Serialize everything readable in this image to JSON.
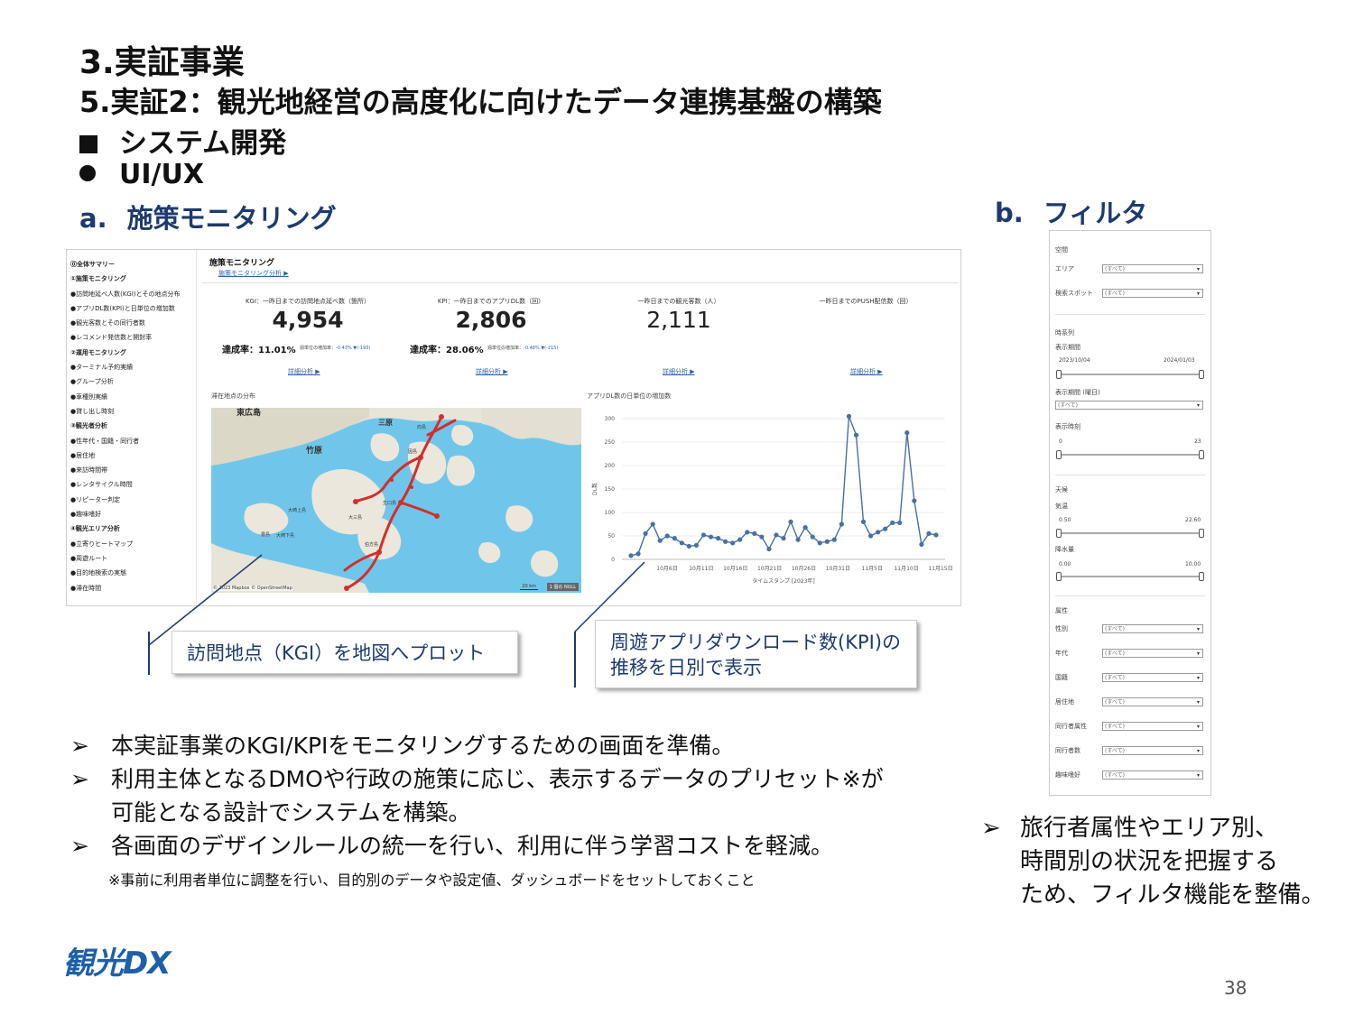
{
  "header": {
    "title": "3.実証事業",
    "subtitle": "5.実証2：観光地経営の高度化に向けたデータ連携基盤の構築",
    "section": "システム開発",
    "subsection": "UI/UX"
  },
  "sections": {
    "a_label": "a.",
    "a_title": "施策モニタリング",
    "b_label": "b.",
    "b_title": "フィルタ"
  },
  "dashboard": {
    "sidebar": [
      {
        "text": "⓪全体サマリー",
        "group": true
      },
      {
        "text": "①施策モニタリング",
        "group": true
      },
      {
        "text": "●訪問地延べ人数(KGI)とその地点分布",
        "group": false
      },
      {
        "text": "●アプリDL数(KPI)と日単位の増加数",
        "group": false
      },
      {
        "text": "●観光客数とその同行者数",
        "group": false
      },
      {
        "text": "●レコメンド発信数と開封率",
        "group": false
      },
      {
        "text": "②運用モニタリング",
        "group": true
      },
      {
        "text": "●ターミナル予約実績",
        "group": false
      },
      {
        "text": "●グループ分析",
        "group": false
      },
      {
        "text": "●車種別実績",
        "group": false
      },
      {
        "text": "●貸し出し時刻",
        "group": false
      },
      {
        "text": "③観光者分析",
        "group": true
      },
      {
        "text": "●性年代・国籍・同行者",
        "group": false
      },
      {
        "text": "●居住地",
        "group": false
      },
      {
        "text": "●来訪時間帯",
        "group": false
      },
      {
        "text": "●レンタサイクル時間",
        "group": false
      },
      {
        "text": "●リピーター判定",
        "group": false
      },
      {
        "text": "●趣味嗜好",
        "group": false
      },
      {
        "text": "④観光エリア分析",
        "group": true
      },
      {
        "text": "●立寄りヒートマップ",
        "group": false
      },
      {
        "text": "●周遊ルート",
        "group": false
      },
      {
        "text": "●目的地検索の実態",
        "group": false
      },
      {
        "text": "●滞在時間",
        "group": false
      }
    ],
    "page_title": "施策モニタリング",
    "page_link": "施策モニタリング分析 ▶",
    "kpis": [
      {
        "label": "KGI：一昨日までの訪問地点延べ数（箇所）",
        "value": "4,954"
      },
      {
        "label": "KPI：一昨日までのアプリDL数（回）",
        "value": "2,806"
      },
      {
        "label": "一昨日までの観光客数（人）",
        "value": "2,111"
      },
      {
        "label": "一昨日までのPUSH配信数（回）",
        "value": ""
      }
    ],
    "rates": [
      {
        "text": "達成率：11.01%",
        "mini_label": "週単位の増加率：",
        "mini_value": "-0.43% ▼(-193)"
      },
      {
        "text": "達成率：28.06%",
        "mini_label": "週単位の増加率：",
        "mini_value": "-0.48% ▼(-215)"
      }
    ],
    "detail_link": "詳細分析 ▶",
    "map_title": "滞在地点の分布",
    "map_attribution": "© 2023 Mapbox © OpenStreetMap",
    "map_scale": "20 km",
    "map_null": "1 個の NULL",
    "map_places": [
      "東広島",
      "竹原",
      "三原",
      "大崎上島",
      "大崎下島",
      "生口島",
      "因島",
      "向島",
      "豊島",
      "伯方島",
      "大三島"
    ],
    "chart_title": "アプリDL数の日単位の増加数"
  },
  "chart_data": {
    "type": "line",
    "title": "アプリDL数の日単位の増加数",
    "xlabel": "タイムスタンプ [2023年]",
    "ylabel": "DL数",
    "ylim": [
      0,
      300
    ],
    "yticks": [
      0,
      50,
      100,
      150,
      200,
      250,
      300
    ],
    "xtick_labels": [
      "10月6日",
      "10月11日",
      "10月16日",
      "10月21日",
      "10月26日",
      "10月31日",
      "11月5日",
      "11月10日",
      "11月15日"
    ],
    "x": [
      "10/4",
      "10/5",
      "10/6",
      "10/7",
      "10/8",
      "10/9",
      "10/10",
      "10/11",
      "10/12",
      "10/13",
      "10/14",
      "10/15",
      "10/16",
      "10/17",
      "10/18",
      "10/19",
      "10/20",
      "10/21",
      "10/22",
      "10/23",
      "10/24",
      "10/25",
      "10/26",
      "10/27",
      "10/28",
      "10/29",
      "10/30",
      "10/31",
      "11/1",
      "11/2",
      "11/3",
      "11/4",
      "11/5",
      "11/6",
      "11/7",
      "11/8",
      "11/9",
      "11/10",
      "11/11",
      "11/12",
      "11/13",
      "11/14",
      "11/15"
    ],
    "values": [
      8,
      12,
      55,
      75,
      40,
      50,
      45,
      35,
      28,
      30,
      52,
      48,
      45,
      38,
      35,
      42,
      58,
      55,
      48,
      22,
      52,
      45,
      80,
      42,
      68,
      48,
      35,
      38,
      42,
      75,
      305,
      265,
      80,
      50,
      58,
      65,
      78,
      78,
      270,
      125,
      32,
      55,
      52
    ]
  },
  "callouts": {
    "left": "訪問地点（KGI）を地図へプロット",
    "right_line1": "周遊アプリダウンロード数(KPI)の",
    "right_line2": "推移を日別で表示"
  },
  "body": {
    "bullets": [
      [
        "本実証事業のKGI/KPIをモニタリングするための画面を準備。"
      ],
      [
        "利用主体となるDMOや行政の施策に応じ、表示するデータのプリセット※が",
        "可能となる設計でシステムを構築。"
      ],
      [
        "各画面のデザインルールの統一を行い、利用に伴う学習コストを軽減。"
      ]
    ],
    "note": "※事前に利用者単位に調整を行い、目的別のデータや設定値、ダッシュボードをセットしておくこと",
    "right_bullet": [
      "旅行者属性やエリア別、",
      "時間別の状況を把握する",
      "ため、フィルタ機能を整備。"
    ],
    "arrow": "➢"
  },
  "filter_panel": {
    "space_header": "空間",
    "area_label": "エリア",
    "spot_label": "検索スポット",
    "all": "(すべて)",
    "time_header": "時系列",
    "period_label": "表示期間",
    "period_start": "2023/10/04",
    "period_end": "2024/01/03",
    "period_day_label": "表示期間 (曜日)",
    "hour_label": "表示時刻",
    "hour_min": "0",
    "hour_max": "23",
    "weather_header": "天候",
    "temp_label": "気温",
    "temp_min": "0.50",
    "temp_max": "22.60",
    "rain_label": "降水量",
    "rain_min": "0.00",
    "rain_max": "10.00",
    "attr_header": "属性",
    "attrs": [
      "性別",
      "年代",
      "国籍",
      "居住地",
      "同行者属性",
      "同行者数",
      "趣味嗜好"
    ]
  },
  "footer": {
    "logo": "観光DX",
    "page_number": "38"
  },
  "colors": {
    "heading_blue": "#1e3a6e",
    "line_color": "#4a6fa0",
    "map_sea": "#70c6ea",
    "map_route": "#d0302c"
  }
}
